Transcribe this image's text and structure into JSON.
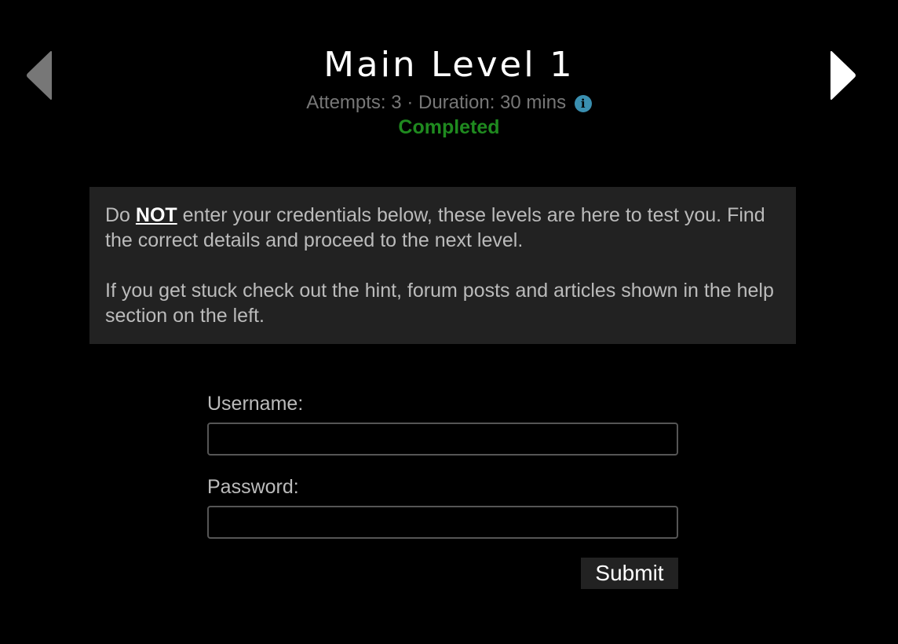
{
  "nav": {
    "prev_icon": "chevron-left-icon",
    "next_icon": "chevron-right-icon"
  },
  "level": {
    "title": "Main Level 1",
    "attempts_label": "Attempts:",
    "attempts_value": "3",
    "separator": "·",
    "duration_label": "Duration:",
    "duration_value": "30 mins",
    "info_icon": "i",
    "status": "Completed"
  },
  "notice": {
    "p1_before": "Do ",
    "p1_emph": "NOT",
    "p1_after": " enter your credentials below, these levels are here to test you. Find the correct details and proceed to the next level.",
    "p2": "If you get stuck check out the hint, forum posts and articles shown in the help section on the left."
  },
  "form": {
    "username_label": "Username:",
    "username_value": "",
    "password_label": "Password:",
    "password_value": "",
    "submit_label": "Submit"
  },
  "colors": {
    "background": "#000000",
    "notice_bg": "#222222",
    "status": "#1f8a1f",
    "info": "#3a8fb0",
    "prev_arrow": "#777777",
    "next_arrow": "#ffffff"
  }
}
